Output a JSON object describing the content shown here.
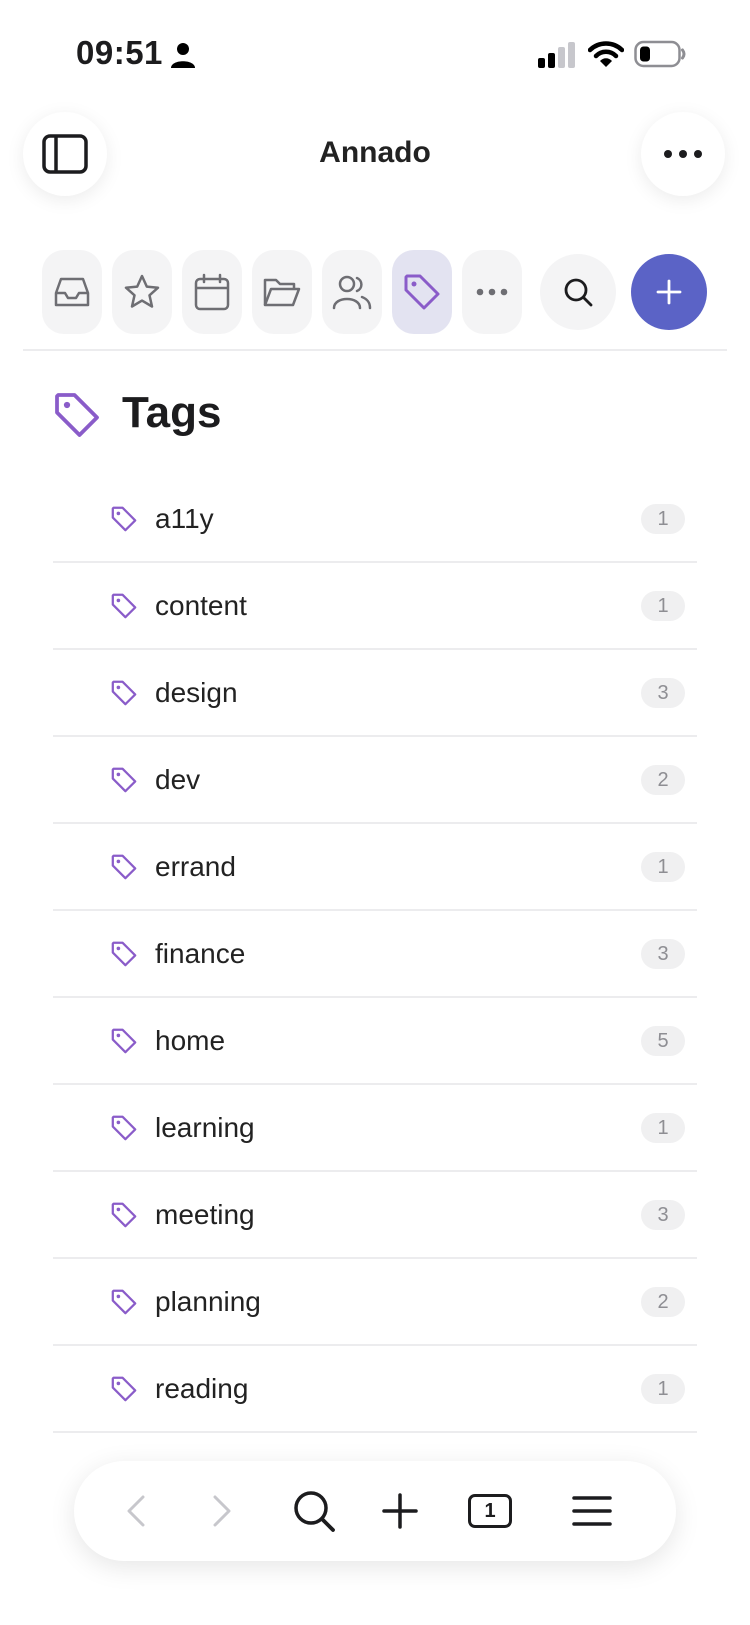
{
  "status_bar": {
    "time": "09:51"
  },
  "header": {
    "title": "Annado"
  },
  "colors": {
    "accent": "#5b63c6",
    "tag": "#8a5cc9",
    "active_tool_bg": "#e3e3f1"
  },
  "toolbar": {
    "tools": [
      {
        "icon": "inbox-icon"
      },
      {
        "icon": "star-icon"
      },
      {
        "icon": "calendar-icon"
      },
      {
        "icon": "folder-icon"
      },
      {
        "icon": "people-icon"
      },
      {
        "icon": "tag-icon",
        "active": true
      },
      {
        "icon": "more-icon"
      }
    ],
    "search_icon": "search-icon",
    "add_icon": "plus-icon"
  },
  "page": {
    "title": "Tags"
  },
  "tags": [
    {
      "label": "a11y",
      "count": "1"
    },
    {
      "label": "content",
      "count": "1"
    },
    {
      "label": "design",
      "count": "3"
    },
    {
      "label": "dev",
      "count": "2"
    },
    {
      "label": "errand",
      "count": "1"
    },
    {
      "label": "finance",
      "count": "3"
    },
    {
      "label": "home",
      "count": "5"
    },
    {
      "label": "learning",
      "count": "1"
    },
    {
      "label": "meeting",
      "count": "3"
    },
    {
      "label": "planning",
      "count": "2"
    },
    {
      "label": "reading",
      "count": "1"
    }
  ],
  "bottom_nav": {
    "tab_count": "1"
  }
}
